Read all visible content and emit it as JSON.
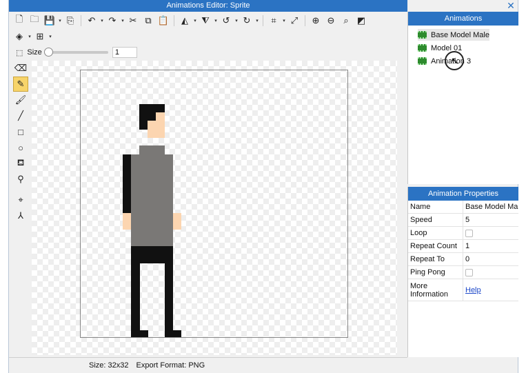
{
  "window": {
    "title": "Animations Editor: Sprite",
    "close_glyph": "✕"
  },
  "toolbar_row1": [
    {
      "name": "new-file-icon",
      "glyph": "🗋"
    },
    {
      "name": "open-folder-icon",
      "glyph": "🗀"
    },
    {
      "name": "save-icon",
      "glyph": "💾",
      "dropdown": true
    },
    {
      "name": "export-icon",
      "glyph": "⎘"
    },
    {
      "sep": true
    },
    {
      "name": "undo-icon",
      "glyph": "↶",
      "dropdown": true
    },
    {
      "name": "redo-icon",
      "glyph": "↷",
      "dropdown": true
    },
    {
      "name": "cut-icon",
      "glyph": "✂"
    },
    {
      "name": "copy-icon",
      "glyph": "⧉"
    },
    {
      "name": "paste-icon",
      "glyph": "📋"
    },
    {
      "sep": true
    },
    {
      "name": "flip-horizontal-icon",
      "glyph": "◭",
      "dropdown": true
    },
    {
      "name": "flip-vertical-icon",
      "glyph": "⧨",
      "dropdown": true
    },
    {
      "name": "rotate-left-icon",
      "glyph": "↺",
      "dropdown": true
    },
    {
      "name": "rotate-right-icon",
      "glyph": "↻",
      "dropdown": true
    },
    {
      "sep": true
    },
    {
      "name": "crop-icon",
      "glyph": "⌗",
      "dropdown": true
    },
    {
      "name": "resize-icon",
      "glyph": "⤢"
    },
    {
      "sep": true
    },
    {
      "name": "zoom-in-icon",
      "glyph": "⊕"
    },
    {
      "name": "zoom-out-icon",
      "glyph": "⊖"
    },
    {
      "name": "zoom-fit-icon",
      "glyph": "⌕"
    },
    {
      "name": "zoom-actual-icon",
      "glyph": "◩"
    }
  ],
  "toolbar_row2": [
    {
      "name": "layers-icon",
      "glyph": "◈",
      "dropdown": true
    },
    {
      "name": "grid-icon",
      "glyph": "⊞",
      "dropdown": true
    }
  ],
  "size_control": {
    "label": "Size",
    "value": "1",
    "selection_icon": "⬚"
  },
  "tools": [
    {
      "name": "eraser-icon",
      "glyph": "⌫",
      "active": false
    },
    {
      "name": "pencil-icon",
      "glyph": "✎",
      "active": true
    },
    {
      "name": "brush-icon",
      "glyph": "🖌",
      "active": false
    },
    {
      "name": "line-icon",
      "glyph": "╱",
      "active": false
    },
    {
      "name": "rectangle-icon",
      "glyph": "□",
      "active": false
    },
    {
      "name": "ellipse-icon",
      "glyph": "○",
      "active": false
    },
    {
      "name": "fill-bucket-icon",
      "glyph": "⛾",
      "active": false
    },
    {
      "name": "eyedropper-icon",
      "glyph": "⚲",
      "active": false
    },
    {
      "name": "move-point-icon",
      "glyph": "⌖",
      "active": false
    },
    {
      "name": "node-tool-icon",
      "glyph": "⅄",
      "active": false
    }
  ],
  "colors": {
    "hair": "#111111",
    "skin": "#fcd5b0",
    "shirt": "#7a7876",
    "pants": "#111111",
    "accent": "#2b73c3"
  },
  "sprite": {
    "grid_size": 32,
    "pixels": [
      {
        "c": "hair",
        "x": 7,
        "y": 4,
        "w": 3,
        "h": 1
      },
      {
        "c": "hair",
        "x": 7,
        "y": 5,
        "w": 1,
        "h": 2
      },
      {
        "c": "hair",
        "x": 8,
        "y": 5,
        "w": 1,
        "h": 1
      },
      {
        "c": "skin",
        "x": 8,
        "y": 6,
        "w": 2,
        "h": 2
      },
      {
        "c": "skin",
        "x": 9,
        "y": 5,
        "w": 1,
        "h": 1
      },
      {
        "c": "shirt",
        "x": 7,
        "y": 9,
        "w": 3,
        "h": 1
      },
      {
        "c": "shirt",
        "x": 6,
        "y": 10,
        "w": 5,
        "h": 11
      },
      {
        "c": "hair",
        "x": 5,
        "y": 10,
        "w": 1,
        "h": 7
      },
      {
        "c": "skin",
        "x": 5,
        "y": 17,
        "w": 1,
        "h": 2
      },
      {
        "c": "skin",
        "x": 11,
        "y": 17,
        "w": 1,
        "h": 2
      },
      {
        "c": "pants",
        "x": 6,
        "y": 21,
        "w": 5,
        "h": 2
      },
      {
        "c": "pants",
        "x": 6,
        "y": 23,
        "w": 1,
        "h": 8
      },
      {
        "c": "pants",
        "x": 10,
        "y": 23,
        "w": 1,
        "h": 8
      },
      {
        "c": "pants",
        "x": 6,
        "y": 31,
        "w": 2,
        "h": 1
      },
      {
        "c": "pants",
        "x": 10,
        "y": 31,
        "w": 2,
        "h": 1
      }
    ]
  },
  "animations_panel": {
    "title": "Animations",
    "items": [
      {
        "label": "Base Model Male",
        "selected": true
      },
      {
        "label": "Model 01",
        "selected": false
      },
      {
        "label": "Animation 3",
        "selected": false
      }
    ]
  },
  "properties_panel": {
    "title": "Animation Properties",
    "rows": [
      {
        "name": "Name",
        "value": "Base Model Male",
        "type": "text"
      },
      {
        "name": "Speed",
        "value": "5",
        "type": "text"
      },
      {
        "name": "Loop",
        "value": "",
        "type": "checkbox"
      },
      {
        "name": "Repeat Count",
        "value": "1",
        "type": "text"
      },
      {
        "name": "Repeat To",
        "value": "0",
        "type": "text"
      },
      {
        "name": "Ping Pong",
        "value": "",
        "type": "checkbox"
      },
      {
        "name": "More Information",
        "value": "Help",
        "type": "link"
      }
    ]
  },
  "status": {
    "size": "Size: 32x32",
    "format": "Export Format: PNG"
  }
}
